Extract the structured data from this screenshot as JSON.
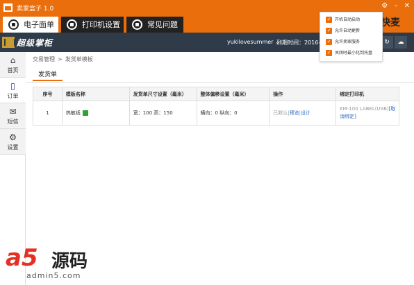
{
  "titlebar": {
    "title": "卖家盒子 1.0",
    "settings_icon": "gear-icon",
    "minimize_icon": "minimize-icon",
    "close_icon": "close-icon"
  },
  "tabs": [
    {
      "label": "电子面单",
      "icon": "waybill-icon",
      "active": true
    },
    {
      "label": "打印机设置",
      "icon": "printer-icon",
      "active": false
    },
    {
      "label": "常见问题",
      "icon": "question-icon",
      "active": false
    }
  ],
  "brand_right": "快麦",
  "navbar": {
    "logo_text": "超级掌柜",
    "username": "yukilovesummer",
    "user_caret": "⌄",
    "expire_text": "到期时间：2016-1-2"
  },
  "sidebar": [
    {
      "label": "首页",
      "icon": "home-icon",
      "glyph": "⌂",
      "active": false
    },
    {
      "label": "订单",
      "icon": "order-icon",
      "glyph": "▯",
      "active": true
    },
    {
      "label": "短信",
      "icon": "mail-icon",
      "glyph": "✉",
      "active": false
    },
    {
      "label": "设置",
      "icon": "gear-icon",
      "glyph": "⚙",
      "active": false
    }
  ],
  "breadcrumb": {
    "part1": "交易管理",
    "sep": ">",
    "part2": "发货单模板"
  },
  "section_tab": "发货单",
  "table": {
    "headers": [
      "序号",
      "模板名称",
      "发货单尺寸设置（毫米）",
      "整体偏移设置（毫米）",
      "操作",
      "绑定打印机"
    ],
    "rows": [
      {
        "index": "1",
        "name": "热敏纸",
        "size": "宽：100  高：150",
        "offset": "横向：0   纵向：0",
        "op_default": "已默认",
        "op_sep1": "|",
        "op_preview": "预览",
        "op_sep2": "|",
        "op_design": "设计",
        "printer": "KM-100 LABEL(USB)",
        "unbind": "[取消绑定]"
      }
    ]
  },
  "popup": {
    "items": [
      {
        "label": "开机自动启动",
        "checked": true
      },
      {
        "label": "允许自动更新",
        "checked": true
      },
      {
        "label": "允许卖家服务",
        "checked": true
      },
      {
        "label": "关闭时最小化到托盘",
        "checked": true
      }
    ],
    "check_glyph": "✓"
  },
  "watermark": {
    "a5": "a5",
    "cn": "源码",
    "url": "admin5.com"
  },
  "colors": {
    "accent": "#ea6e0c",
    "navbar": "#2f3b48",
    "link": "#2a6cc5"
  }
}
